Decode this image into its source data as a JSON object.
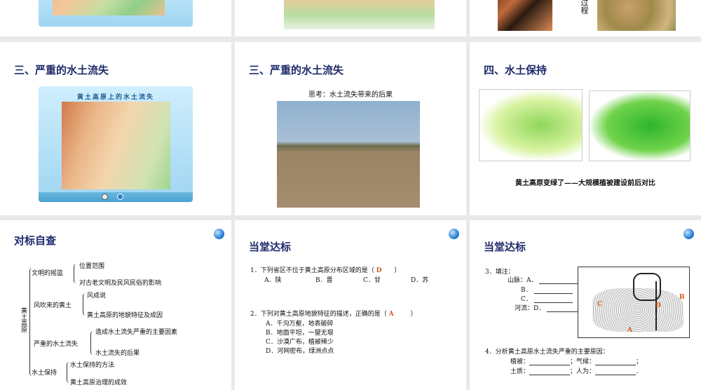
{
  "slides": [
    {
      "id": "top-1",
      "image": "loess-map-frame"
    },
    {
      "id": "top-2",
      "image": "terrain-map"
    },
    {
      "id": "top-3",
      "vertical_text": "过程"
    },
    {
      "id": "s4",
      "title": "三、严重的水土流失",
      "map_title": "黄土高原上的水土流失"
    },
    {
      "id": "s5",
      "title": "三、严重的水土流失",
      "caption": "思考：水土流失带来的后果"
    },
    {
      "id": "s6",
      "title": "四、水土保持",
      "caption": "黄土高原变绿了——大规模植被建设前后对比"
    },
    {
      "id": "s7",
      "title": "对标自查",
      "root": "黄土高原",
      "branches": [
        {
          "label": "文明的摇篮",
          "items": [
            "位置范围",
            "对古老文明及民风民俗的影响"
          ]
        },
        {
          "label": "风吹来的黄土",
          "items": [
            "风成说",
            "黄土高原的地貌特征及成因"
          ]
        },
        {
          "label": "严重的水土流失",
          "items": [
            "造成水土流失严重的主要因素",
            "水土流失的后果"
          ]
        },
        {
          "label": "水土保持",
          "items": [
            "水土保持的方法",
            "黄土高原治理的成效"
          ]
        }
      ]
    },
    {
      "id": "s8",
      "title": "当堂达标",
      "q1": {
        "text": "1．下列省区不位于黄土高原分布区域的是（",
        "answer": "D",
        "close": "）",
        "options": [
          "A．陕",
          "B．晋",
          "C．甘",
          "D．苏"
        ]
      },
      "q2": {
        "text": "2．下列对黄土高原地貌特征的描述，正确的是（",
        "answer": "A",
        "close": "）",
        "options": [
          "A．千沟万壑，地表破碎",
          "B．地面平坦，一望无垠",
          "C．沙漠广布，植被稀少",
          "D．河网密布，绿洲点点"
        ]
      }
    },
    {
      "id": "s9",
      "title": "当堂达标",
      "q3": {
        "text": "3．填注：",
        "rows": [
          "山脉：A．",
          "B．",
          "C．",
          "河流：D．"
        ],
        "map_labels": [
          "A",
          "B",
          "C",
          "D"
        ]
      },
      "q4": {
        "text": "4．分析黄土高原水土流失严重的主要原因：",
        "fields": [
          "植被：",
          "；气候：",
          "；",
          "土质：",
          "；人为：",
          "．"
        ]
      }
    }
  ]
}
